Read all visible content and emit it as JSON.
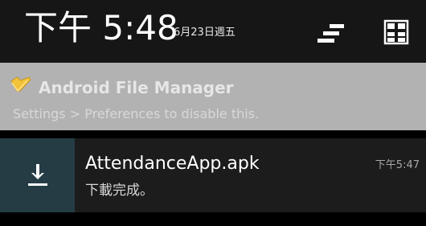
{
  "status": {
    "time": "下午 5:48",
    "date": "6月23日週五"
  },
  "header_icons": {
    "quick_settings": "quick-settings-icon",
    "clear_all": "clear-all-icon"
  },
  "notifications": [
    {
      "icon": "file-manager-icon",
      "title": "Android File Manager",
      "subtitle": "Settings > Preferences to disable this."
    },
    {
      "icon": "download-icon",
      "title": "AttendanceApp.apk",
      "subtitle": "下載完成。",
      "time": "下午5:47"
    }
  ],
  "colors": {
    "header_bg": "#161616",
    "notification1_bg": "#b2b2b2",
    "notification2_bg": "#1c1c1c",
    "download_icon_bg": "#253c45",
    "file_manager_icon": "#f2c23a"
  }
}
